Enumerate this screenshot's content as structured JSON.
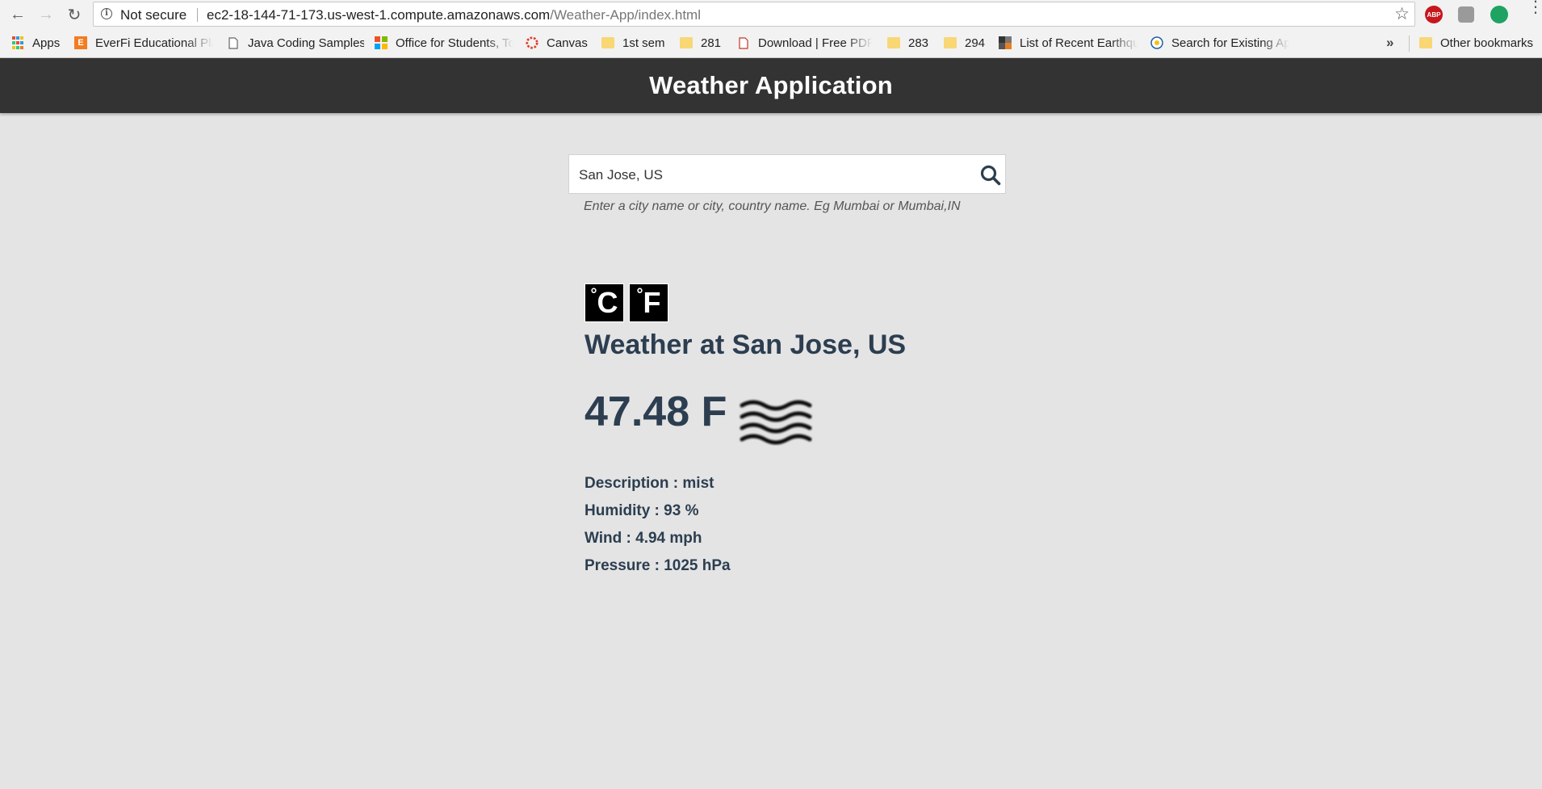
{
  "browser": {
    "security_label": "Not secure",
    "url_host": "ec2-18-144-71-173.us-west-1.compute.amazonaws.com",
    "url_path": "/Weather-App/index.html",
    "extensions": [
      "ABP"
    ],
    "bookmarks": [
      {
        "label": "Apps",
        "icon": "apps-grid-icon"
      },
      {
        "label": "EverFi Educational Pla",
        "icon": "everfi-icon"
      },
      {
        "label": "Java Coding Samples",
        "icon": "page-icon"
      },
      {
        "label": "Office for Students, To",
        "icon": "microsoft-icon"
      },
      {
        "label": "Canvas",
        "icon": "canvas-icon"
      },
      {
        "label": "1st sem",
        "icon": "folder-icon"
      },
      {
        "label": "281",
        "icon": "folder-icon"
      },
      {
        "label": "Download | Free PDF",
        "icon": "pdf-icon"
      },
      {
        "label": "283",
        "icon": "folder-icon"
      },
      {
        "label": "294",
        "icon": "folder-icon"
      },
      {
        "label": "List of Recent Earthqu",
        "icon": "earthquake-icon"
      },
      {
        "label": "Search for Existing Ap",
        "icon": "globe-icon"
      }
    ],
    "more_bookmarks": "»",
    "other_bookmarks": "Other bookmarks"
  },
  "app": {
    "title": "Weather Application"
  },
  "search": {
    "value": "San Jose, US",
    "hint": "Enter a city name or city, country name. Eg Mumbai or Mumbai,IN"
  },
  "units": {
    "celsius": "C",
    "fahrenheit": "F",
    "degree": "°"
  },
  "weather": {
    "heading": "Weather at San Jose, US",
    "temperature": "47.48 F",
    "icon": "mist-icon",
    "description": "Description : mist",
    "humidity": "Humidity : 93 %",
    "wind": "Wind : 4.94 mph",
    "pressure": "Pressure : 1025 hPa"
  },
  "colors": {
    "header_bg": "#333333",
    "page_bg": "#e4e4e4",
    "text_dark": "#2c3e50"
  }
}
